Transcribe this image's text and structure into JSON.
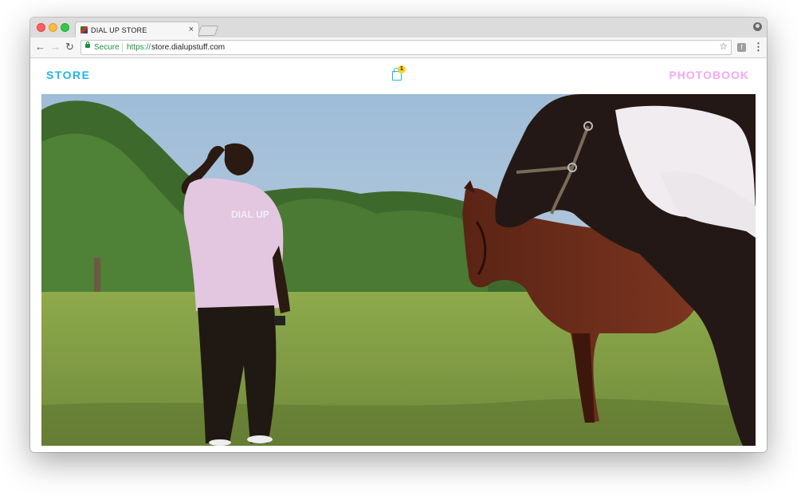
{
  "browser": {
    "tab_title": "DIAL UP STORE",
    "tab_close": "×",
    "secure_label": "Secure",
    "url_scheme": "https://",
    "url_host": "store.dialupstuff.com",
    "nav_back": "←",
    "nav_forward": "→",
    "nav_reload": "↻",
    "bookmark_star": "☆",
    "menu": "⋮",
    "extension_glyph": "f"
  },
  "site": {
    "store_link": "STORE",
    "photobook_link": "PHOTOBOOK",
    "cart_count": "1",
    "shirt_print": "DIAL UP",
    "colors": {
      "store": "#1fb4ea",
      "photobook": "#f6a6f3",
      "cart_badge": "#ffd21f"
    }
  },
  "hero_image": {
    "description_icons": [
      "person-figure",
      "brown-horse",
      "pinto-horse",
      "tree-line",
      "grass-field"
    ]
  }
}
